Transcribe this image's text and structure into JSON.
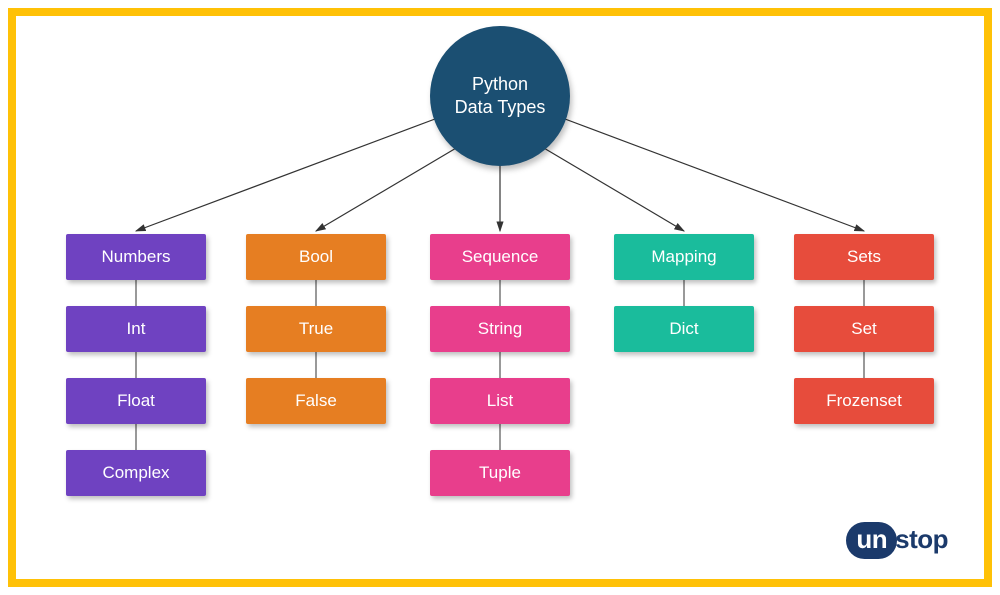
{
  "root": {
    "line1": "Python",
    "line2": "Data Types"
  },
  "categories": [
    {
      "label": "Numbers",
      "color": "c-purple",
      "children": [
        "Int",
        "Float",
        "Complex"
      ]
    },
    {
      "label": "Bool",
      "color": "c-orange",
      "children": [
        "True",
        "False"
      ]
    },
    {
      "label": "Sequence",
      "color": "c-pink",
      "children": [
        "String",
        "List",
        "Tuple"
      ]
    },
    {
      "label": "Mapping",
      "color": "c-green",
      "children": [
        "Dict"
      ]
    },
    {
      "label": "Sets",
      "color": "c-red",
      "children": [
        "Set",
        "Frozenset"
      ]
    }
  ],
  "logo": {
    "part1": "un",
    "part2": "stop"
  },
  "colors": {
    "border": "#FFC107",
    "root": "#1b4f72",
    "purple": "#6f42c1",
    "orange": "#e67e22",
    "pink": "#e83e8c",
    "green": "#1abc9c",
    "red": "#e74c3c"
  }
}
